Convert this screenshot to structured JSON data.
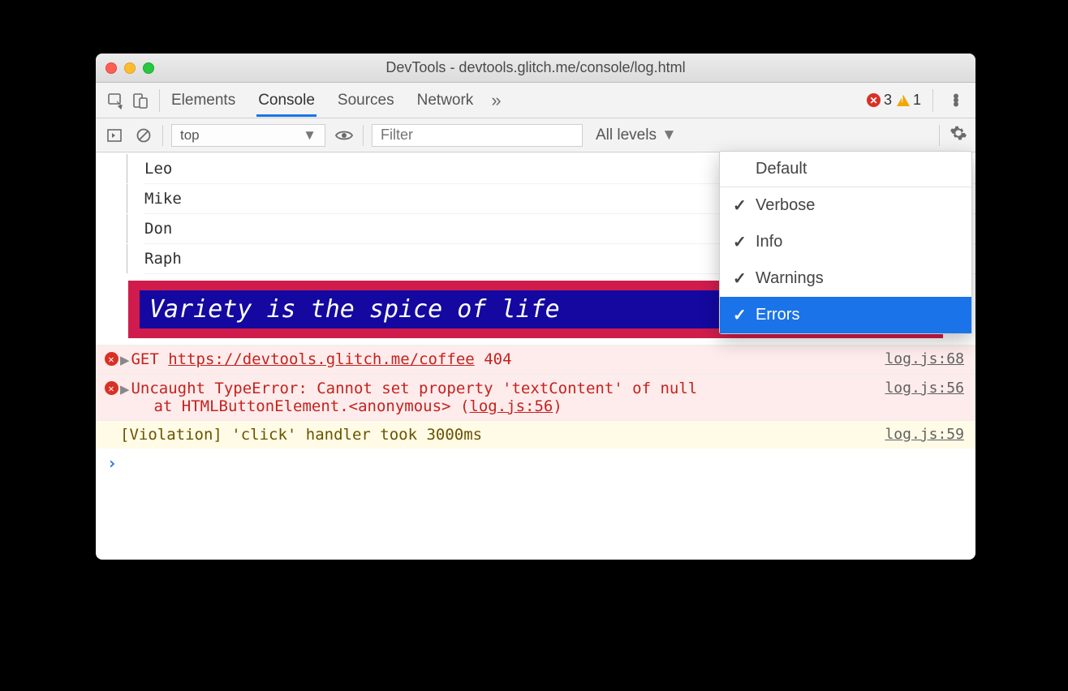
{
  "window": {
    "title": "DevTools - devtools.glitch.me/console/log.html"
  },
  "tabs": {
    "items": [
      "Elements",
      "Console",
      "Sources",
      "Network"
    ],
    "active_index": 1,
    "more_glyph": "»"
  },
  "badges": {
    "errors": "3",
    "warnings": "1"
  },
  "toolbar": {
    "context": "top",
    "filter_placeholder": "Filter",
    "levels_label": "All levels"
  },
  "log_tree": [
    "Leo",
    "Mike",
    "Don",
    "Raph"
  ],
  "styled_message": "Variety is the spice of life",
  "messages": [
    {
      "type": "error",
      "method": "GET",
      "url": "https://devtools.glitch.me/coffee",
      "status": "404",
      "source": "log.js:68"
    },
    {
      "type": "error",
      "text": "Uncaught TypeError: Cannot set property 'textContent' of null",
      "stack_prefix": "at HTMLButtonElement.<anonymous> (",
      "stack_link": "log.js:56",
      "stack_suffix": ")",
      "source": "log.js:56"
    },
    {
      "type": "warn",
      "text": "[Violation] 'click' handler took 3000ms",
      "source": "log.js:59"
    }
  ],
  "dropdown": {
    "default_label": "Default",
    "items": [
      {
        "label": "Verbose",
        "checked": true,
        "selected": false
      },
      {
        "label": "Info",
        "checked": true,
        "selected": false
      },
      {
        "label": "Warnings",
        "checked": true,
        "selected": false
      },
      {
        "label": "Errors",
        "checked": true,
        "selected": true
      }
    ]
  }
}
